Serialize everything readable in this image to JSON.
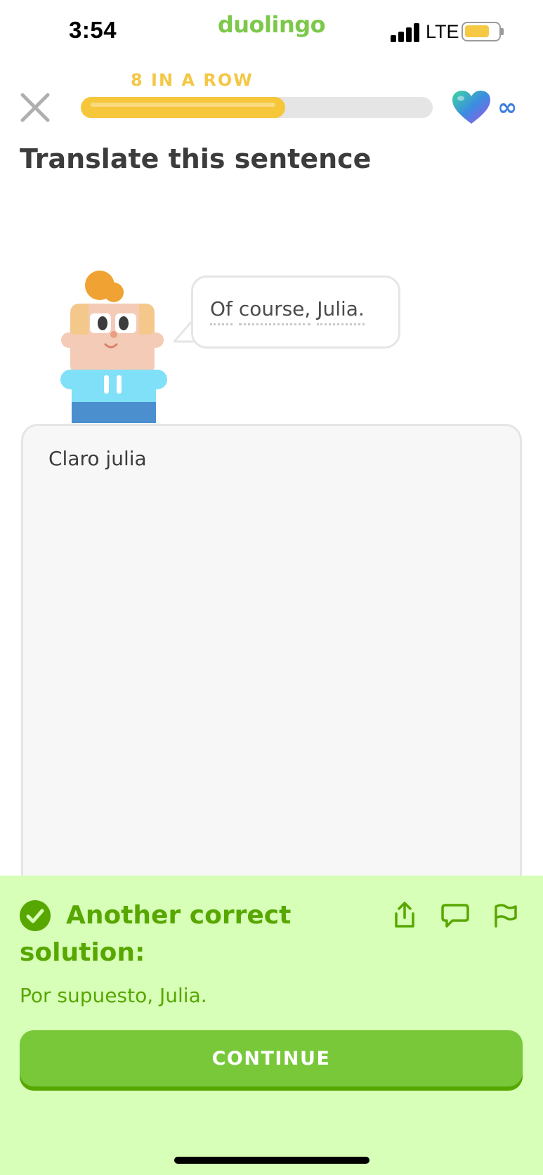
{
  "status_bar": {
    "time": "3:54",
    "app_name": "duolingo",
    "network": "LTE"
  },
  "header": {
    "streak_text": "8 IN A ROW",
    "progress_fraction": 0.58,
    "hearts": "∞"
  },
  "exercise": {
    "title": "Translate this sentence",
    "prompt_words": [
      "Of",
      "course,",
      "Julia."
    ],
    "answer": "Claro julia"
  },
  "feedback": {
    "title": "Another correct solution:",
    "solution": "Por supuesto, Julia.",
    "continue_label": "CONTINUE"
  },
  "colors": {
    "accent_green": "#58a700",
    "button_green": "#78c83a",
    "panel_bg": "#d7ffb8",
    "streak_yellow": "#f5c746"
  },
  "icons": [
    "close-icon",
    "heart-icon",
    "infinity-icon",
    "check-icon",
    "share-icon",
    "comment-icon",
    "report-flag-icon"
  ]
}
